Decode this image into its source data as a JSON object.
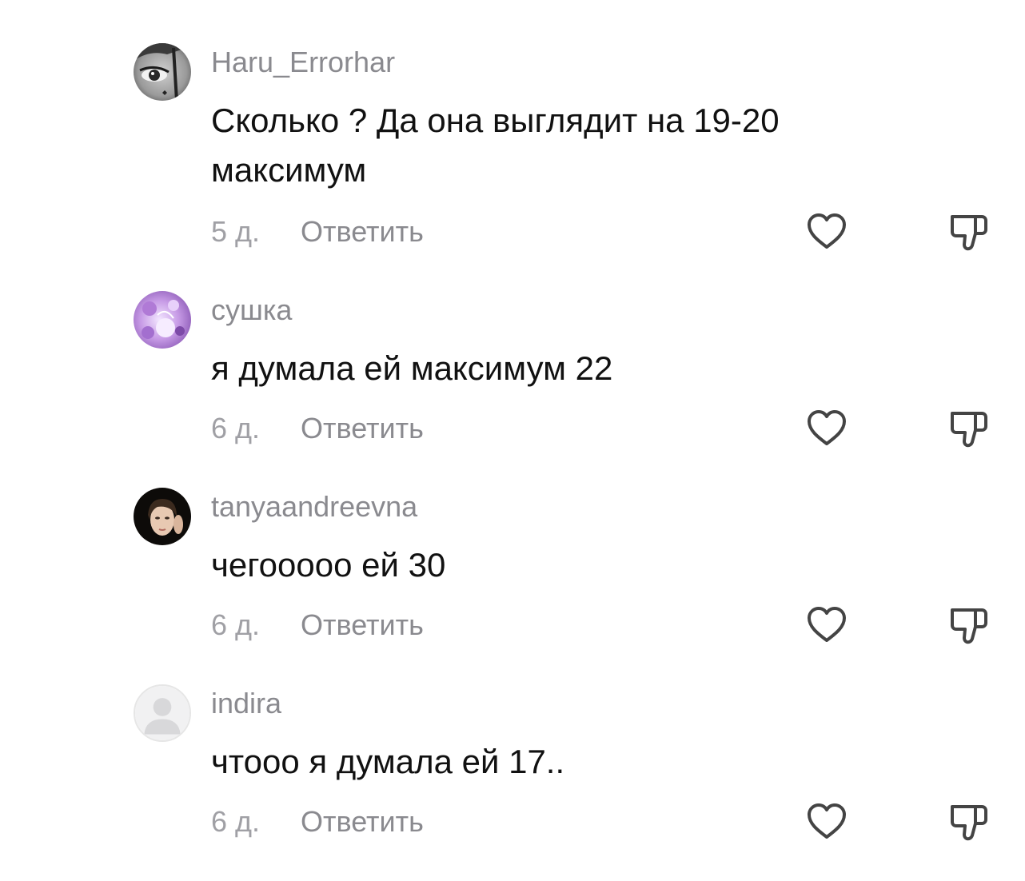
{
  "comments": [
    {
      "username": "Haru_Errorhar",
      "text": "Сколько ? Да она выглядит на 19-20 максимум",
      "time": "5 д.",
      "reply": "Ответить",
      "avatar": "dark-eye-avatar"
    },
    {
      "username": "сушка",
      "text": "я думала ей максимум 22",
      "time": "6 д.",
      "reply": "Ответить",
      "avatar": "purple-anime-avatar"
    },
    {
      "username": "tanyaandreevna",
      "text": "чегооооо ей 30",
      "time": "6 д.",
      "reply": "Ответить",
      "avatar": "portrait-photo-avatar"
    },
    {
      "username": "indira",
      "text": "чтооо я думала ей 17..",
      "time": "6 д.",
      "reply": "Ответить",
      "avatar": "default-user-avatar"
    }
  ],
  "icons": {
    "like": "heart-icon",
    "dislike": "thumbs-down-icon"
  },
  "colors": {
    "username": "#8a8a8f",
    "text": "#111111",
    "meta": "#a0a0a5",
    "background": "#ffffff"
  }
}
